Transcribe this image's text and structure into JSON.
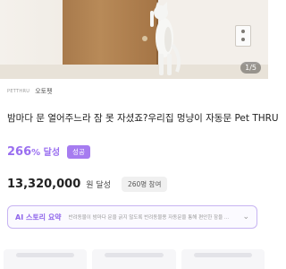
{
  "hero": {
    "image_alt": "cat standing at door",
    "counter": "1/5"
  },
  "brand": {
    "logo_text": "PETTHRU",
    "name": "오토펫"
  },
  "title": "밤마다 문 열어주느라 잠 못 자셨죠?우리집 멍냥이 자동문 Pet THRU",
  "funding": {
    "rate": "266",
    "rate_suffix": "% 달성",
    "badge": "성공",
    "amount": "13,320,000",
    "amount_suffix": "원 달성",
    "participants": "260명 참여"
  },
  "ai_summary": {
    "label": "AI 스토리 요약",
    "text": "반려동물이 밤마다 문을 긁지 않도록 반려동물용 자동문을 통해 편안한 잠을 ..."
  },
  "bottom_cards": {
    "count": 3
  },
  "colors": {
    "accent": "#9a6ff0",
    "badge_bg": "#a67cf0",
    "ai_border": "#c7b4f2"
  }
}
